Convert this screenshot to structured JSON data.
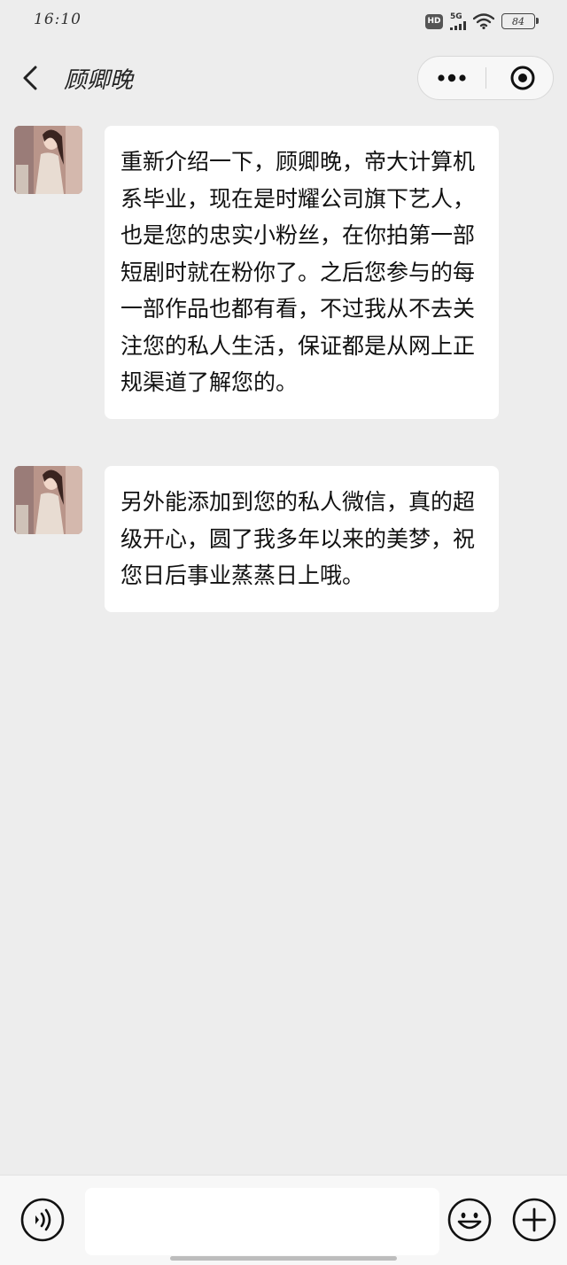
{
  "status_bar": {
    "time": "16:10",
    "hd_badge": "HD",
    "network": "5G",
    "battery": "84",
    "icons": [
      "hd-icon",
      "signal-icon",
      "wifi-icon",
      "battery-icon"
    ]
  },
  "nav": {
    "title": "顾卿晚",
    "back_icon": "chevron-left-icon",
    "more_icon": "more-dots-icon",
    "close_icon": "target-close-icon"
  },
  "messages": [
    {
      "sender": "顾卿晚",
      "text": "重新介绍一下，顾卿晚，帝大计算机系毕业，现在是时耀公司旗下艺人，也是您的忠实小粉丝，在你拍第一部短剧时就在粉你了。之后您参与的每一部作品也都有看，不过我从不去关注您的私人生活，保证都是从网上正规渠道了解您的。"
    },
    {
      "sender": "顾卿晚",
      "text": "另外能添加到您的私人微信，真的超级开心，圆了我多年以来的美梦，祝您日后事业蒸蒸日上哦。"
    }
  ],
  "input_bar": {
    "placeholder": "",
    "voice_icon": "voice-icon",
    "emoji_icon": "emoji-icon",
    "plus_icon": "plus-icon"
  },
  "colors": {
    "background": "#ededed",
    "bubble": "#ffffff",
    "text": "#111111"
  }
}
